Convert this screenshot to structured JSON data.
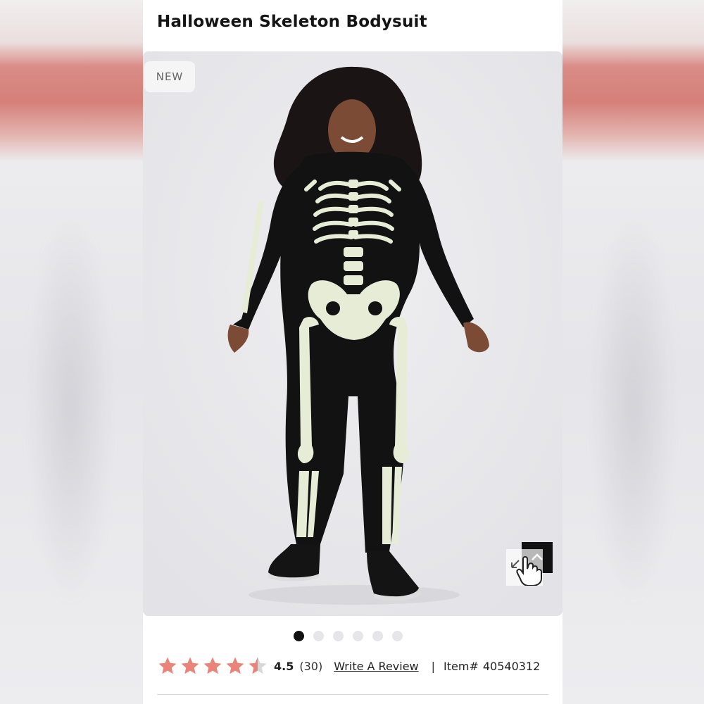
{
  "product": {
    "title": "Halloween Skeleton Bodysuit",
    "badge": "NEW"
  },
  "gallery": {
    "image_count": 6,
    "active_index": 0
  },
  "rating": {
    "value": "4.5",
    "count": "(30)",
    "stars_filled_fraction": 0.9,
    "write_review_label": "Write A Review",
    "separator": "|",
    "item_label": "Item#",
    "item_number": "40540312"
  },
  "colors": {
    "star": "#e8847a",
    "star_empty": "#d8d8dc",
    "suit": "#111111",
    "bones": "#e6ecd6"
  },
  "icons": {
    "zoom": "expand-arrows-icon",
    "hand": "hand-pointer-icon",
    "scroll_up": "chevron-up-icon"
  }
}
